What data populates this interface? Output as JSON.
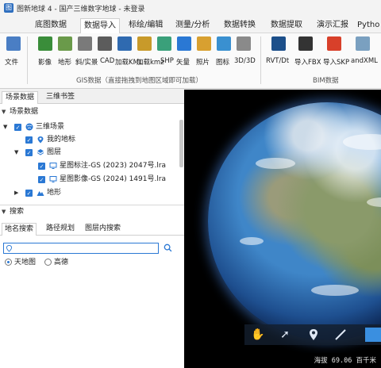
{
  "window": {
    "title": "图新地球 4 - 国产三维数字地球 - 未登录"
  },
  "menu": {
    "tabs": [
      "底图数据",
      "数据导入",
      "标绘/编辑",
      "测量/分析",
      "数据转换",
      "数据提取",
      "演示汇报",
      "Pytho"
    ],
    "active_index": 1
  },
  "ribbon": {
    "file_label": "文件",
    "gis_buttons": [
      "影像",
      "地形",
      "斜/实景",
      "CAD",
      "加载KML",
      "加载kmz",
      "SHP",
      "矢量",
      "照片",
      "图标",
      "3D/3D"
    ],
    "gis_group_label": "GIS数据（直接拖拽到地图区域即可加载）",
    "bim_buttons": [
      "RVT/Dt",
      "导入FBX",
      "导入SKP",
      "andXML"
    ],
    "bim_group_label": "BIM数据",
    "icon_colors": {
      "file": "#4a7ec4",
      "image": "#3a8d3a",
      "terrain": "#6a9a4a",
      "oblique": "#7a7a7a",
      "cad": "#5c5c5c",
      "kml": "#2f6ab0",
      "kmz": "#c89a2a",
      "shp": "#3aa07a",
      "vector": "#2a78d4",
      "photo": "#d8a030",
      "icon": "#3a90d0",
      "model": "#8a8a8a",
      "rvt": "#1c4f8a",
      "fbx": "#333333",
      "skp": "#d8402a",
      "landxml": "#7aa0c0"
    }
  },
  "left": {
    "tabs": [
      "场景数据",
      "三维书签"
    ],
    "active_tab": 0,
    "scene_section": "场景数据",
    "tree": {
      "root": "三维场景",
      "my_marks": "我的地标",
      "layers": "图层",
      "layer_items": [
        "星图标注-GS (2023) 2047号.lra",
        "星图影像-GS (2024) 1491号.lra"
      ],
      "terrain": "地形"
    },
    "search_section": "搜索",
    "search_tabs": [
      "地名搜索",
      "路径规划",
      "图层内搜索"
    ],
    "search_active": 0,
    "search_value": "",
    "radio_options": [
      "天地图",
      "高德"
    ],
    "radio_selected": 0
  },
  "viewport": {
    "status": "海拔 69.06 百千米",
    "tools": [
      "pan-hand-icon",
      "select-cursor-icon",
      "place-mark-icon",
      "draw-line-icon"
    ]
  }
}
